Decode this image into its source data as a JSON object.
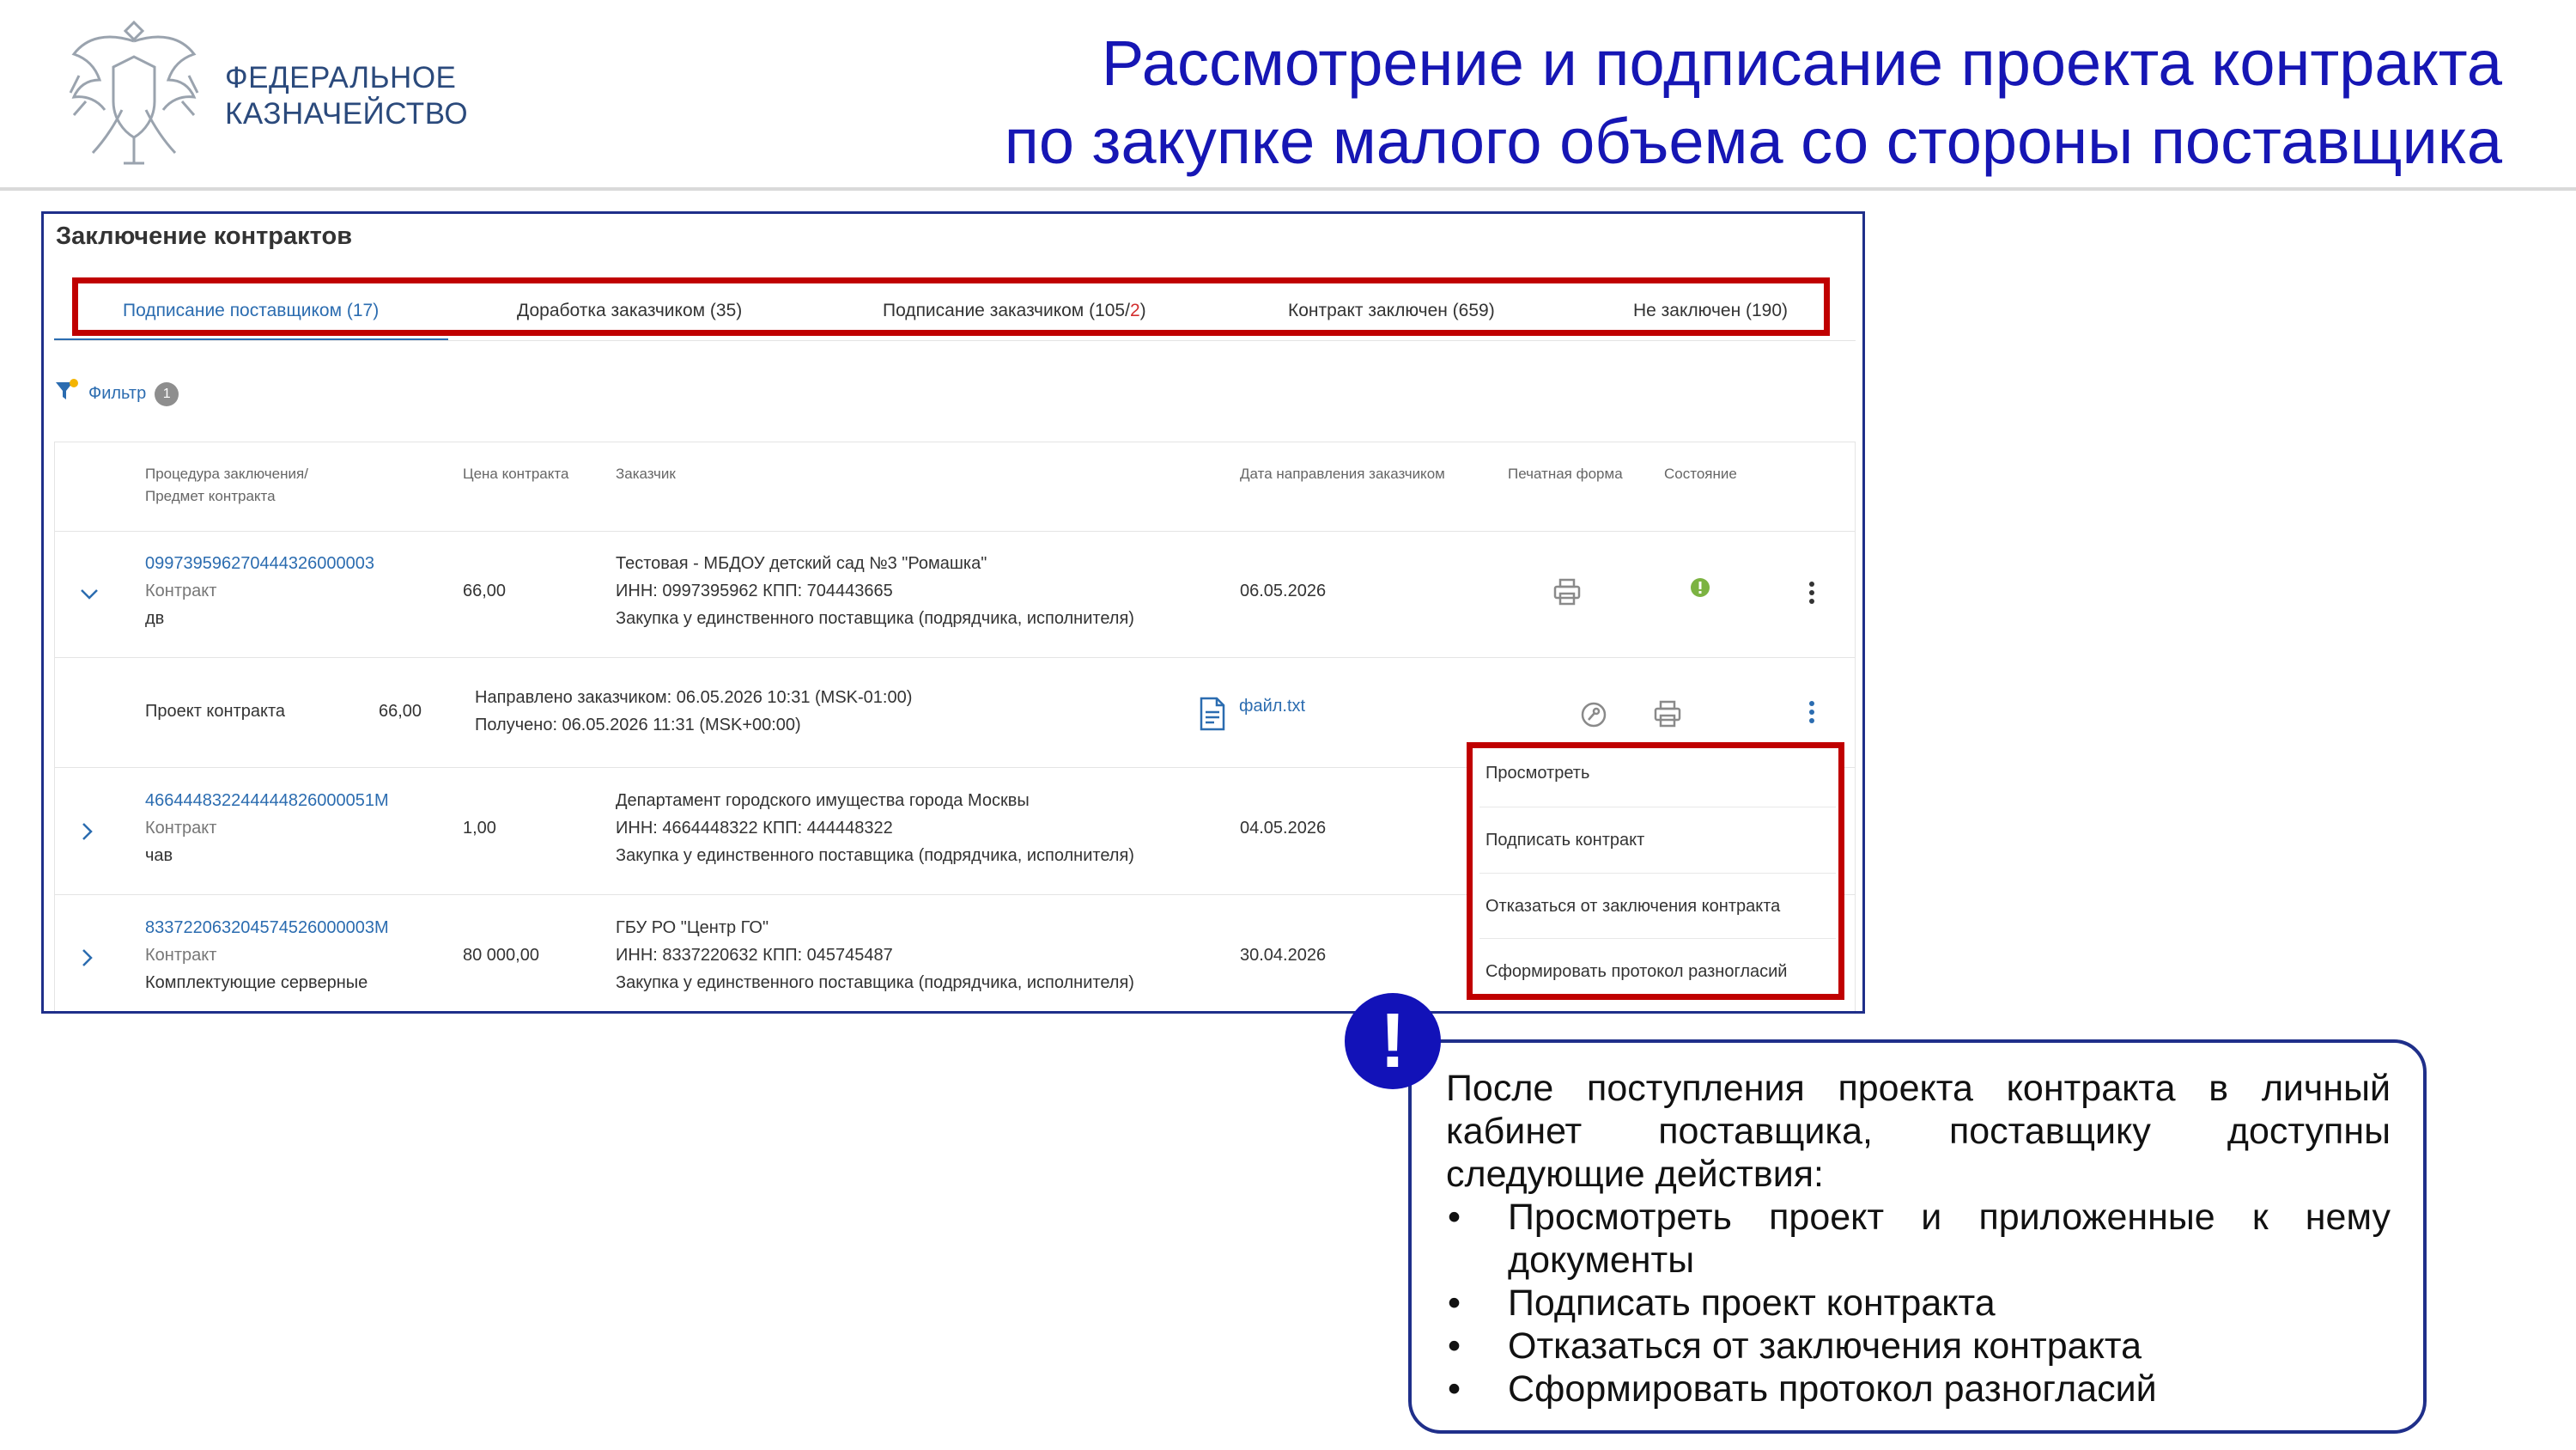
{
  "header": {
    "org_line1": "ФЕДЕРАЛЬНОЕ",
    "org_line2": "КАЗНАЧЕЙСТВО",
    "title_line1": "Рассмотрение и подписание проекта контракта",
    "title_line2": "по закупке малого объема со стороны поставщика"
  },
  "panel": {
    "title": "Заключение контрактов",
    "tabs": [
      {
        "label": "Подписание поставщиком (17)",
        "active": true
      },
      {
        "label": "Доработка заказчиком (35)",
        "active": false
      },
      {
        "label_main": "Подписание заказчиком (105/",
        "label_red": "2",
        "label_end": ")",
        "active": false
      },
      {
        "label": "Контракт заключен (659)",
        "active": false
      },
      {
        "label": "Не заключен (190)",
        "active": false
      }
    ],
    "filter": {
      "label": "Фильтр",
      "count": "1"
    },
    "columns": {
      "procedure_line1": "Процедура заключения/",
      "procedure_line2": "Предмет контракта",
      "price": "Цена контракта",
      "customer": "Заказчик",
      "sent_date": "Дата направления заказчиком",
      "print_form": "Печатная форма",
      "state": "Состояние"
    },
    "rows": [
      {
        "number": "099739596270444326000003",
        "type": "Контракт",
        "subject": "дв",
        "price": "66,00",
        "customer_name": "Тестовая - МБДОУ детский сад №3 \"Ромашка\"",
        "customer_ids": "ИНН: 0997395962 КПП: 704443665",
        "purchase_type": "Закупка у единственного поставщика (подрядчика, исполнителя)",
        "date": "06.05.2026"
      },
      {
        "number": "466444832244444826000051М",
        "type": "Контракт",
        "subject": "чав",
        "price": "1,00",
        "customer_name": "Департамент городского имущества города Москвы",
        "customer_ids": "ИНН: 4664448322 КПП: 444448322",
        "purchase_type": "Закупка у единственного поставщика (подрядчика, исполнителя)",
        "date": "04.05.2026"
      },
      {
        "number": "833722063204574526000003М",
        "type": "Контракт",
        "subject": "Комплектующие серверные",
        "price": "80 000,00",
        "customer_name": "ГБУ РО \"Центр ГО\"",
        "customer_ids": "ИНН: 8337220632 КПП: 045745487",
        "purchase_type": "Закупка у единственного поставщика (подрядчика, исполнителя)",
        "date": "30.04.2026"
      }
    ],
    "subrow": {
      "label": "Проект контракта",
      "price": "66,00",
      "sent": "Направлено заказчиком: 06.05.2026 10:31 (MSK-01:00)",
      "received": "Получено: 06.05.2026 11:31 (MSK+00:00)",
      "file": "файл.txt"
    },
    "menu": [
      "Просмотреть",
      "Подписать контракт",
      "Отказаться от заключения контракта",
      "Сформировать протокол разногласий"
    ]
  },
  "callout": {
    "badge": "!",
    "intro": "После поступления проекта контракта в личный кабинет поставщика, поставщику доступны следующие действия:",
    "items": [
      "Просмотреть проект и приложенные к нему документы",
      "Подписать проект контракта",
      "Отказаться от заключения контракта",
      "Сформировать протокол разногласий"
    ]
  },
  "colors": {
    "title": "#1616b4",
    "accent_link": "#2b6cb0",
    "highlight_border": "#c00000",
    "panel_border": "#1f2f8a",
    "state_ok": "#7cb342"
  }
}
